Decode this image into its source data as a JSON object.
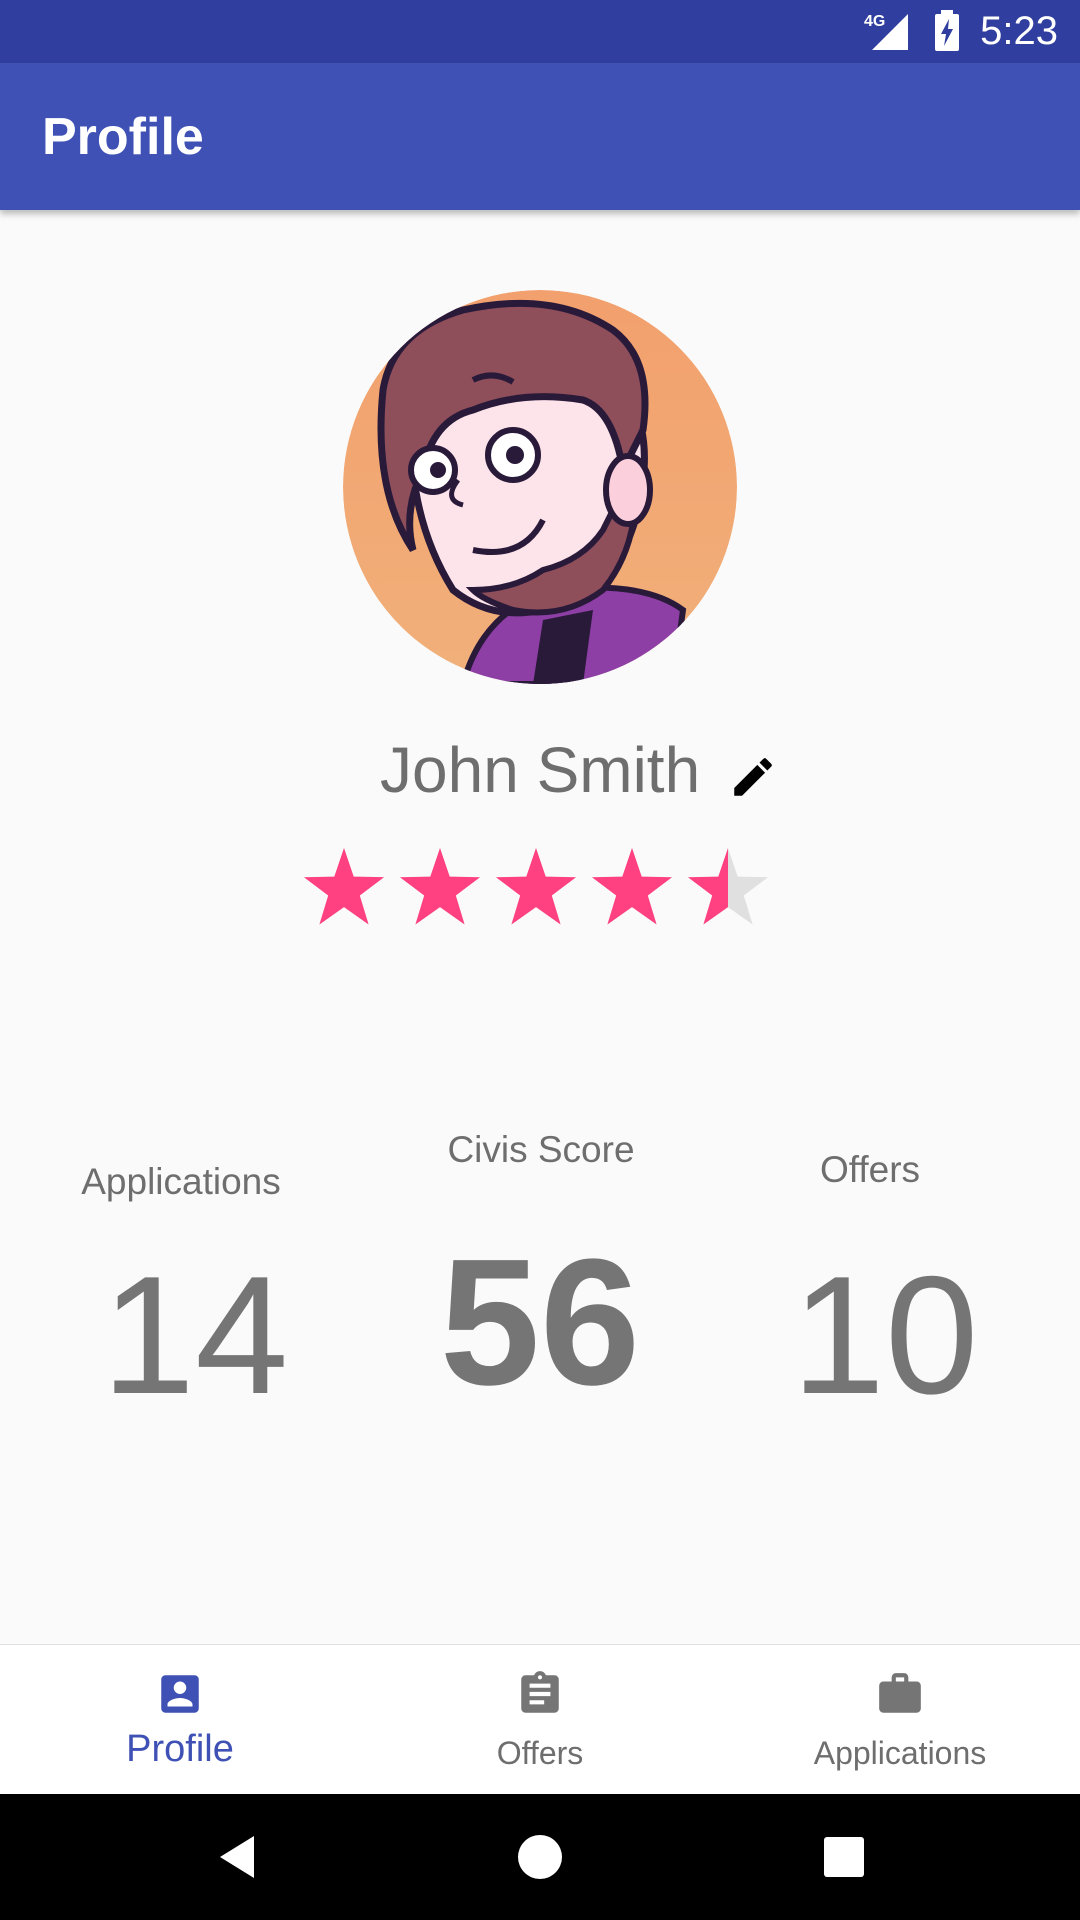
{
  "status_bar": {
    "time": "5:23",
    "network": "4G",
    "signal_icon": "signal-icon",
    "battery_icon": "battery-charging-icon",
    "background": "#303f9f"
  },
  "app_bar": {
    "title": "Profile",
    "background": "#3f51b5"
  },
  "profile": {
    "avatar_icon": "avatar-illustration",
    "name": "John Smith",
    "edit_icon": "pencil-icon",
    "rating": 4.5,
    "rating_max": 5,
    "star_color": "#ff4081"
  },
  "stats": {
    "applications": {
      "label": "Applications",
      "value": "14"
    },
    "civis_score": {
      "label": "Civis Score",
      "value": "56"
    },
    "offers": {
      "label": "Offers",
      "value": "10"
    }
  },
  "bottom_nav": {
    "active_color": "#3f51b5",
    "items": [
      {
        "label": "Profile",
        "icon": "account-box-icon",
        "active": true
      },
      {
        "label": "Offers",
        "icon": "clipboard-icon",
        "active": false
      },
      {
        "label": "Applications",
        "icon": "briefcase-icon",
        "active": false
      }
    ]
  },
  "system_nav": {
    "back_icon": "back-triangle-icon",
    "home_icon": "home-circle-icon",
    "recents_icon": "recents-square-icon"
  }
}
